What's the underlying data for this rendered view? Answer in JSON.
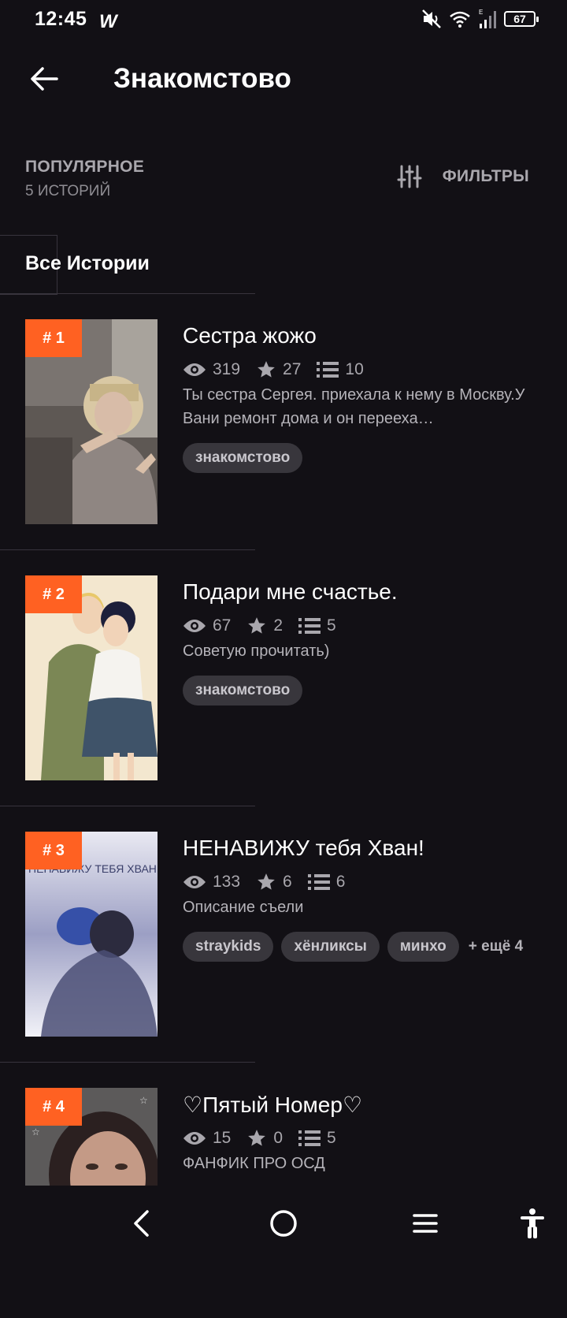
{
  "status_bar": {
    "time": "12:45",
    "app_logo": "W",
    "battery_level": "67",
    "icons": [
      "mute-icon",
      "wifi-icon",
      "signal-icon",
      "battery-icon"
    ]
  },
  "header": {
    "title": "Знакомстово",
    "back_icon": "arrow-left-icon"
  },
  "sort": {
    "label": "ПОПУЛЯРНОЕ",
    "count": "5 ИСТОРИЙ",
    "filters_label": "ФИЛЬТРЫ",
    "filters_icon": "sliders-icon"
  },
  "tab": {
    "label": "Все Истории"
  },
  "stories": [
    {
      "rank": "# 1",
      "title": "Сестра жожо",
      "views": "319",
      "votes": "27",
      "parts": "10",
      "description": "Ты сестра Сергея. приехала к нему в Москву.У Вани ремонт дома и он переехa…",
      "tags": [
        "знакомстово"
      ],
      "more": ""
    },
    {
      "rank": "# 2",
      "title": "Подари мне счастье.",
      "views": "67",
      "votes": "2",
      "parts": "5",
      "description": "Советую прочитать)",
      "tags": [
        "знакомстово"
      ],
      "more": ""
    },
    {
      "rank": "# 3",
      "title": "НЕНАВИЖУ тебя Хван!",
      "views": "133",
      "votes": "6",
      "parts": "6",
      "description": "Описание съели",
      "tags": [
        "straykids",
        "хёнликсы",
        "минхо"
      ],
      "more": "+ ещё 4",
      "cover_text": "НЕНАВИЖУ ТЕБЯ ХВАН!"
    },
    {
      "rank": "# 4",
      "title": "♡Пятый Номер♡",
      "views": "15",
      "votes": "0",
      "parts": "5",
      "description": "ФАНФИК ПРО  ОСД",
      "tags": [],
      "more": ""
    }
  ],
  "nav_bar": {
    "icons": [
      "nav-back-icon",
      "nav-home-icon",
      "nav-menu-icon",
      "accessibility-icon"
    ]
  },
  "colors": {
    "background": "#121015",
    "accent": "#ff6122",
    "tag_bg": "#38363c",
    "muted_text": "#a9a7ad"
  }
}
